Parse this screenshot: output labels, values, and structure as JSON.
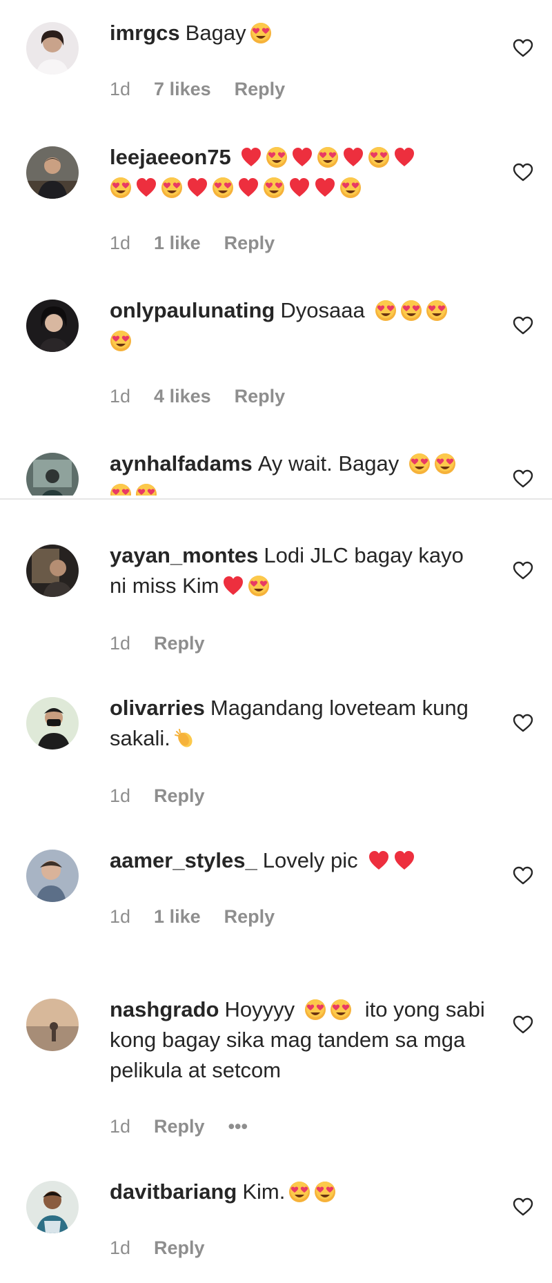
{
  "comments_top": [
    {
      "username": "imrgcs",
      "text": "Bagay",
      "emojis": [
        "heart-eyes"
      ],
      "time": "1d",
      "likes": "7 likes",
      "reply": "Reply"
    },
    {
      "username": "leejaeeon75",
      "text": "",
      "emojis": [
        "red-heart",
        "heart-eyes",
        "red-heart",
        "heart-eyes",
        "red-heart",
        "heart-eyes",
        "red-heart",
        "heart-eyes",
        "red-heart",
        "heart-eyes",
        "red-heart",
        "heart-eyes",
        "red-heart",
        "heart-eyes",
        "red-heart",
        "red-heart",
        "heart-eyes"
      ],
      "time": "1d",
      "likes": "1 like",
      "reply": "Reply"
    },
    {
      "username": "onlypaulunating",
      "text": "Dyosaaa",
      "emojis": [
        "heart-eyes",
        "heart-eyes",
        "heart-eyes",
        "heart-eyes"
      ],
      "time": "1d",
      "likes": "4 likes",
      "reply": "Reply"
    },
    {
      "username": "aynhalfadams",
      "text": "Ay wait. Bagay",
      "emojis": [
        "heart-eyes",
        "heart-eyes",
        "heart-eyes",
        "heart-eyes"
      ],
      "time": "",
      "likes": "",
      "reply": ""
    }
  ],
  "comments_bottom": [
    {
      "username": "yayan_montes",
      "text": "Lodi JLC bagay kayo ni miss Kim",
      "emojis": [
        "red-heart",
        "heart-eyes"
      ],
      "time": "1d",
      "likes": "",
      "reply": "Reply"
    },
    {
      "username": "olivarries",
      "text": "Magandang loveteam kung sakali.",
      "emojis": [
        "clapping-hands"
      ],
      "time": "1d",
      "likes": "",
      "reply": "Reply"
    },
    {
      "username": "aamer_styles_",
      "text": "Lovely pic",
      "emojis": [
        "red-heart",
        "red-heart"
      ],
      "time": "1d",
      "likes": "1 like",
      "reply": "Reply"
    },
    {
      "username": "nashgrado",
      "text_before": "Hoyyyy",
      "emojis": [
        "heart-eyes",
        "heart-eyes"
      ],
      "text_after": "ito yong sabi kong bagay sika mag tandem sa mga pelikula at setcom",
      "time": "1d",
      "likes": "",
      "reply": "Reply",
      "more": "•••"
    },
    {
      "username": "davitbariang",
      "text": "Kim.",
      "emojis": [
        "heart-eyes",
        "heart-eyes"
      ],
      "time": "1d",
      "likes": "",
      "reply": "Reply"
    }
  ],
  "icons": {
    "like": "heart-outline-icon",
    "heart_eyes": "smiling-face-with-heart-eyes",
    "red_heart": "red-heart",
    "clap": "clapping-hands"
  },
  "colors": {
    "username": "#262626",
    "meta": "#8e8e8e",
    "heart": "#ed2f3e",
    "emoji_face": "#f6b23a",
    "emoji_eye_heart": "#e83a64"
  }
}
